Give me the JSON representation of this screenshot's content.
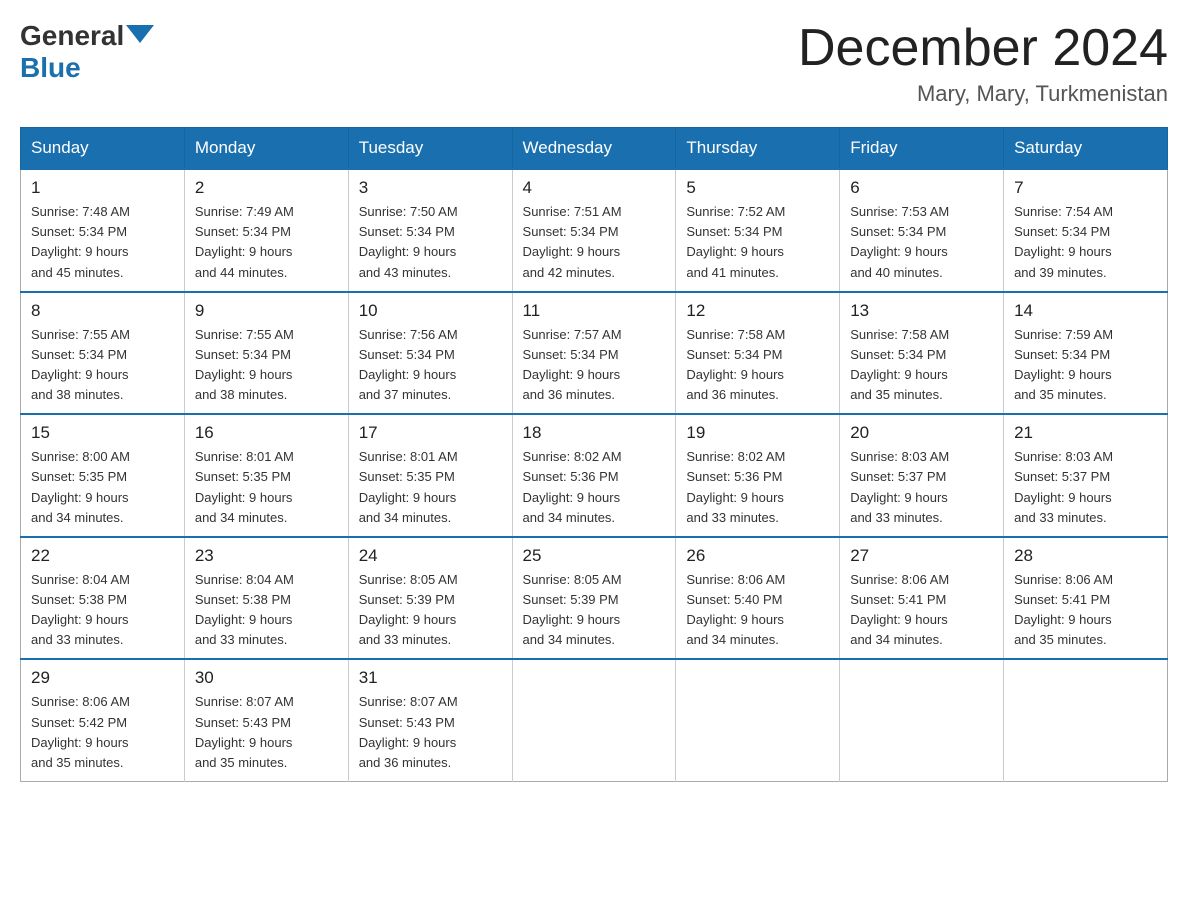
{
  "header": {
    "logo": {
      "general": "General",
      "blue": "Blue"
    },
    "month_title": "December 2024",
    "location": "Mary, Mary, Turkmenistan"
  },
  "weekdays": [
    "Sunday",
    "Monday",
    "Tuesday",
    "Wednesday",
    "Thursday",
    "Friday",
    "Saturday"
  ],
  "weeks": [
    [
      {
        "day": "1",
        "sunrise": "7:48 AM",
        "sunset": "5:34 PM",
        "daylight": "9 hours and 45 minutes."
      },
      {
        "day": "2",
        "sunrise": "7:49 AM",
        "sunset": "5:34 PM",
        "daylight": "9 hours and 44 minutes."
      },
      {
        "day": "3",
        "sunrise": "7:50 AM",
        "sunset": "5:34 PM",
        "daylight": "9 hours and 43 minutes."
      },
      {
        "day": "4",
        "sunrise": "7:51 AM",
        "sunset": "5:34 PM",
        "daylight": "9 hours and 42 minutes."
      },
      {
        "day": "5",
        "sunrise": "7:52 AM",
        "sunset": "5:34 PM",
        "daylight": "9 hours and 41 minutes."
      },
      {
        "day": "6",
        "sunrise": "7:53 AM",
        "sunset": "5:34 PM",
        "daylight": "9 hours and 40 minutes."
      },
      {
        "day": "7",
        "sunrise": "7:54 AM",
        "sunset": "5:34 PM",
        "daylight": "9 hours and 39 minutes."
      }
    ],
    [
      {
        "day": "8",
        "sunrise": "7:55 AM",
        "sunset": "5:34 PM",
        "daylight": "9 hours and 38 minutes."
      },
      {
        "day": "9",
        "sunrise": "7:55 AM",
        "sunset": "5:34 PM",
        "daylight": "9 hours and 38 minutes."
      },
      {
        "day": "10",
        "sunrise": "7:56 AM",
        "sunset": "5:34 PM",
        "daylight": "9 hours and 37 minutes."
      },
      {
        "day": "11",
        "sunrise": "7:57 AM",
        "sunset": "5:34 PM",
        "daylight": "9 hours and 36 minutes."
      },
      {
        "day": "12",
        "sunrise": "7:58 AM",
        "sunset": "5:34 PM",
        "daylight": "9 hours and 36 minutes."
      },
      {
        "day": "13",
        "sunrise": "7:58 AM",
        "sunset": "5:34 PM",
        "daylight": "9 hours and 35 minutes."
      },
      {
        "day": "14",
        "sunrise": "7:59 AM",
        "sunset": "5:34 PM",
        "daylight": "9 hours and 35 minutes."
      }
    ],
    [
      {
        "day": "15",
        "sunrise": "8:00 AM",
        "sunset": "5:35 PM",
        "daylight": "9 hours and 34 minutes."
      },
      {
        "day": "16",
        "sunrise": "8:01 AM",
        "sunset": "5:35 PM",
        "daylight": "9 hours and 34 minutes."
      },
      {
        "day": "17",
        "sunrise": "8:01 AM",
        "sunset": "5:35 PM",
        "daylight": "9 hours and 34 minutes."
      },
      {
        "day": "18",
        "sunrise": "8:02 AM",
        "sunset": "5:36 PM",
        "daylight": "9 hours and 34 minutes."
      },
      {
        "day": "19",
        "sunrise": "8:02 AM",
        "sunset": "5:36 PM",
        "daylight": "9 hours and 33 minutes."
      },
      {
        "day": "20",
        "sunrise": "8:03 AM",
        "sunset": "5:37 PM",
        "daylight": "9 hours and 33 minutes."
      },
      {
        "day": "21",
        "sunrise": "8:03 AM",
        "sunset": "5:37 PM",
        "daylight": "9 hours and 33 minutes."
      }
    ],
    [
      {
        "day": "22",
        "sunrise": "8:04 AM",
        "sunset": "5:38 PM",
        "daylight": "9 hours and 33 minutes."
      },
      {
        "day": "23",
        "sunrise": "8:04 AM",
        "sunset": "5:38 PM",
        "daylight": "9 hours and 33 minutes."
      },
      {
        "day": "24",
        "sunrise": "8:05 AM",
        "sunset": "5:39 PM",
        "daylight": "9 hours and 33 minutes."
      },
      {
        "day": "25",
        "sunrise": "8:05 AM",
        "sunset": "5:39 PM",
        "daylight": "9 hours and 34 minutes."
      },
      {
        "day": "26",
        "sunrise": "8:06 AM",
        "sunset": "5:40 PM",
        "daylight": "9 hours and 34 minutes."
      },
      {
        "day": "27",
        "sunrise": "8:06 AM",
        "sunset": "5:41 PM",
        "daylight": "9 hours and 34 minutes."
      },
      {
        "day": "28",
        "sunrise": "8:06 AM",
        "sunset": "5:41 PM",
        "daylight": "9 hours and 35 minutes."
      }
    ],
    [
      {
        "day": "29",
        "sunrise": "8:06 AM",
        "sunset": "5:42 PM",
        "daylight": "9 hours and 35 minutes."
      },
      {
        "day": "30",
        "sunrise": "8:07 AM",
        "sunset": "5:43 PM",
        "daylight": "9 hours and 35 minutes."
      },
      {
        "day": "31",
        "sunrise": "8:07 AM",
        "sunset": "5:43 PM",
        "daylight": "9 hours and 36 minutes."
      },
      null,
      null,
      null,
      null
    ]
  ],
  "labels": {
    "sunrise": "Sunrise:",
    "sunset": "Sunset:",
    "daylight": "Daylight:"
  }
}
